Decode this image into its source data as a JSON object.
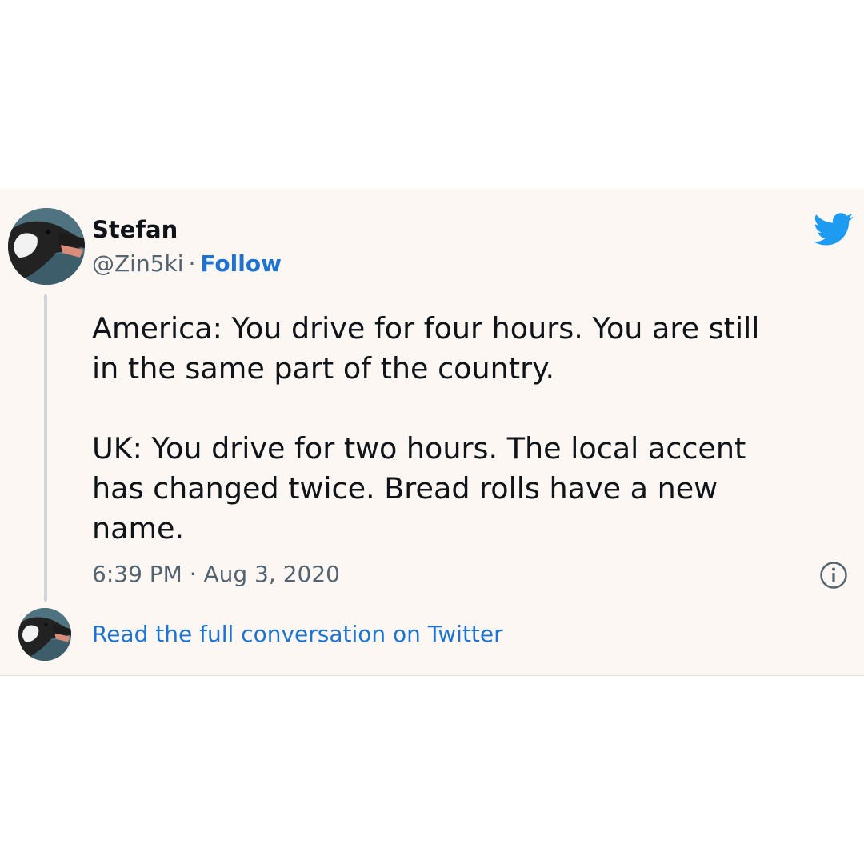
{
  "author": {
    "name": "Stefan",
    "handle": "@Zin5ki",
    "separator": "·",
    "follow_label": "Follow"
  },
  "tweet": {
    "text": "America: You drive for four hours. You are still\nin the same part of the country.\n\nUK: You drive for two hours. The local accent\nhas changed twice. Bread rolls have a new\nname.",
    "timestamp": "6:39 PM · Aug 3, 2020"
  },
  "footer": {
    "read_label": "Read the full conversation on Twitter"
  },
  "icons": {
    "brand": "twitter-bird-icon",
    "info": "info-icon"
  },
  "colors": {
    "accent": "#1d73cf",
    "twitter_blue": "#1d9bf0",
    "muted_text": "#536471",
    "card_background": "#fdf7f4"
  }
}
